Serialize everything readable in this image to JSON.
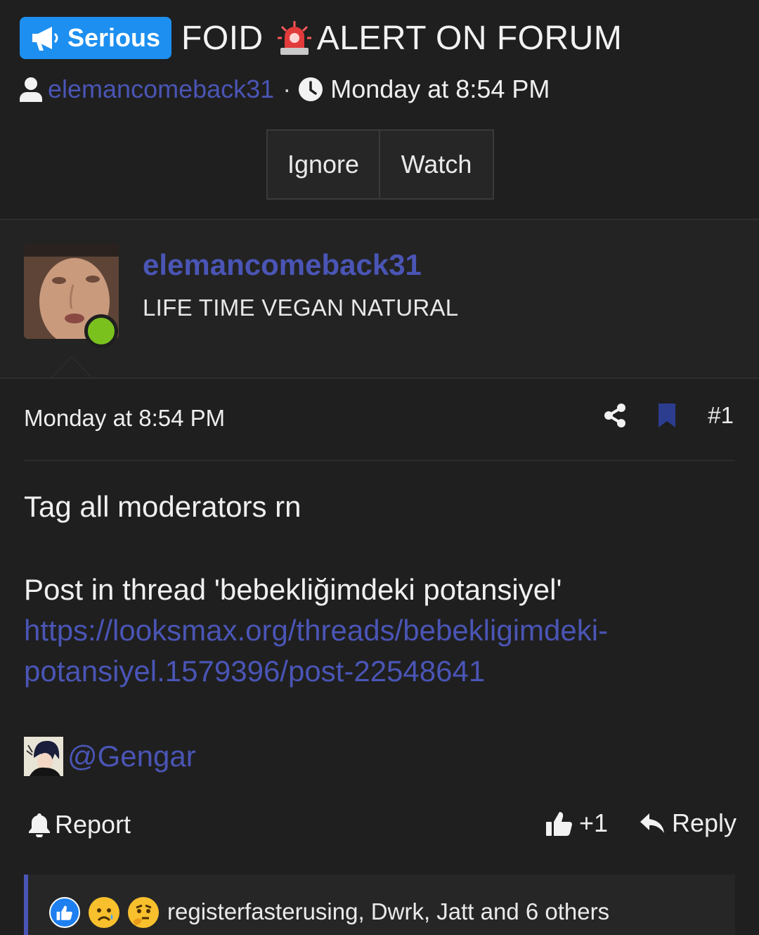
{
  "thread": {
    "prefix": "Serious",
    "title_part1": "FOID",
    "title_part2": "ALERT ON FORUM",
    "author": "elemancomeback31",
    "separator": "·",
    "date": "Monday at 8:54 PM",
    "buttons": {
      "ignore": "Ignore",
      "watch": "Watch"
    }
  },
  "post": {
    "author_name": "elemancomeback31",
    "author_title": "LIFE TIME VEGAN NATURAL",
    "date": "Monday at 8:54 PM",
    "number": "#1",
    "body_line1": "Tag all moderators rn",
    "body_line2": "Post in thread 'bebekliğimdeki potansiyel'",
    "link_line1": "https://looksmax.org/threads/bebekligimdeki-",
    "link_line2": "potansiyel.1579396/post-22548641",
    "mention": "@Gengar"
  },
  "actions": {
    "report": "Report",
    "like": "+1",
    "reply": "Reply"
  },
  "reactions": {
    "summary": "registerfasterusing, Dwrk, Jatt and 6 others",
    "icons": [
      "like-reaction-icon",
      "sad-reaction-icon",
      "thinking-reaction-icon"
    ]
  },
  "colors": {
    "accent": "#4a55b5",
    "prefix_bg": "#1d8ff0",
    "online": "#7bc11e",
    "background": "#1f1f1f"
  }
}
